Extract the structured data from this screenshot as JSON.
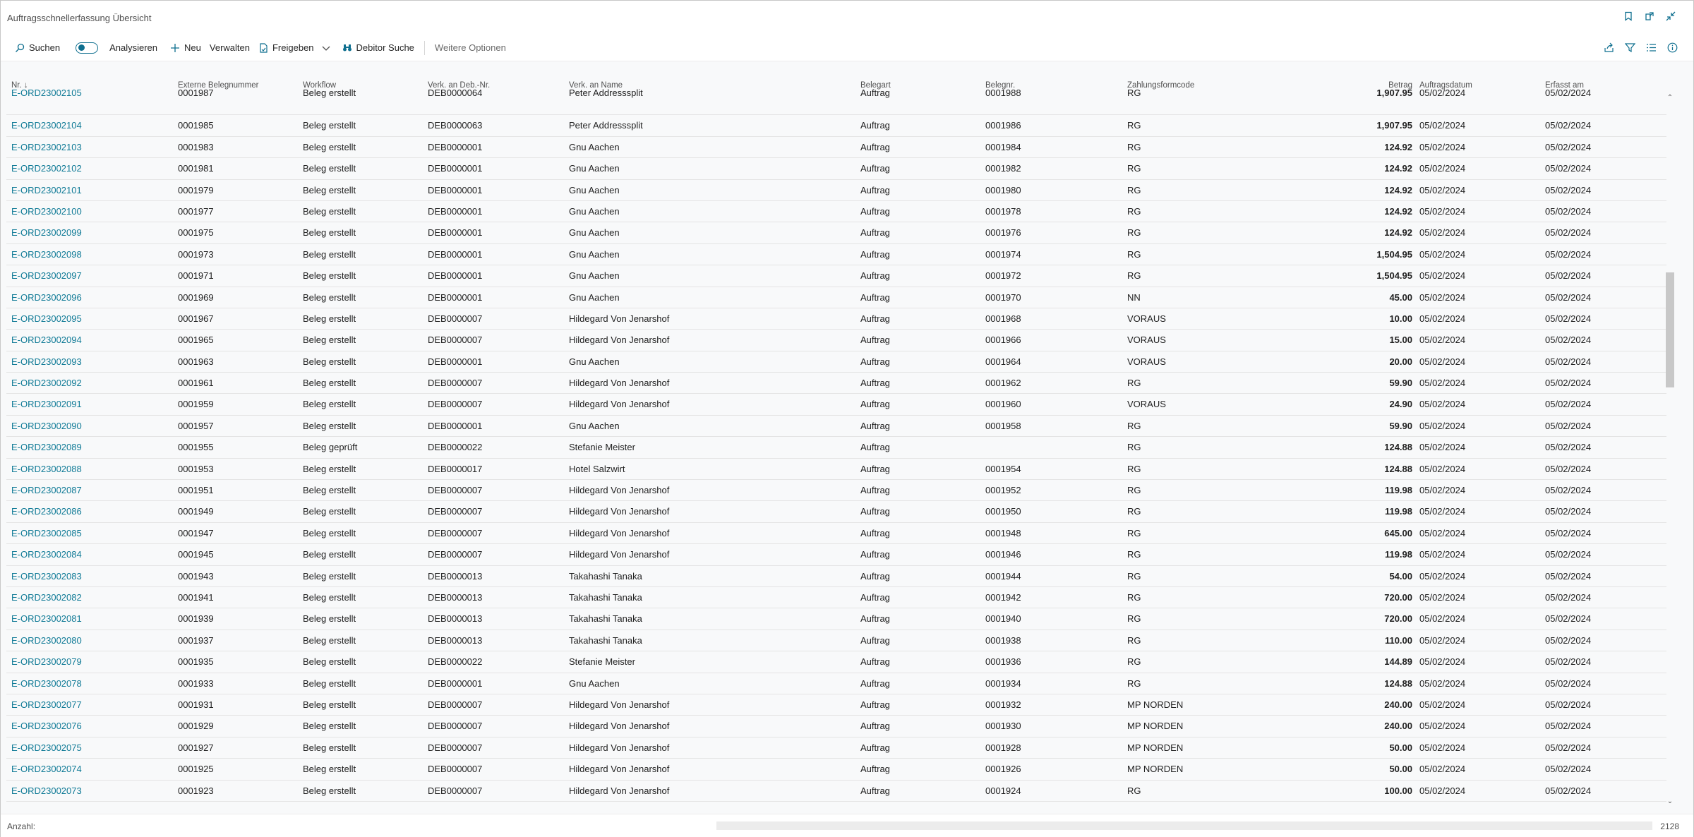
{
  "window": {
    "title": "Auftragsschnellerfassung Übersicht"
  },
  "actions": {
    "search": "Suchen",
    "analyze": "Analysieren",
    "new": "Neu",
    "manage": "Verwalten",
    "release": "Freigeben",
    "debitor_search": "Debitor Suche",
    "more_options": "Weitere Optionen"
  },
  "columns": [
    "Nr. ↓",
    "Externe Belegnummer",
    "Workflow",
    "Verk. an Deb.-Nr.",
    "Verk. an Name",
    "Belegart",
    "Belegnr.",
    "Zahlungsformcode",
    "Betrag",
    "Auftragsdatum",
    "Erfasst am"
  ],
  "rows": [
    [
      "E-ORD23002105",
      "0001987",
      "Beleg erstellt",
      "DEB0000064",
      "Peter Addresssplit",
      "Auftrag",
      "0001988",
      "RG",
      "1,907.95",
      "05/02/2024",
      "05/02/2024"
    ],
    [
      "E-ORD23002104",
      "0001985",
      "Beleg erstellt",
      "DEB0000063",
      "Peter Addresssplit",
      "Auftrag",
      "0001986",
      "RG",
      "1,907.95",
      "05/02/2024",
      "05/02/2024"
    ],
    [
      "E-ORD23002103",
      "0001983",
      "Beleg erstellt",
      "DEB0000001",
      "Gnu Aachen",
      "Auftrag",
      "0001984",
      "RG",
      "124.92",
      "05/02/2024",
      "05/02/2024"
    ],
    [
      "E-ORD23002102",
      "0001981",
      "Beleg erstellt",
      "DEB0000001",
      "Gnu Aachen",
      "Auftrag",
      "0001982",
      "RG",
      "124.92",
      "05/02/2024",
      "05/02/2024"
    ],
    [
      "E-ORD23002101",
      "0001979",
      "Beleg erstellt",
      "DEB0000001",
      "Gnu Aachen",
      "Auftrag",
      "0001980",
      "RG",
      "124.92",
      "05/02/2024",
      "05/02/2024"
    ],
    [
      "E-ORD23002100",
      "0001977",
      "Beleg erstellt",
      "DEB0000001",
      "Gnu Aachen",
      "Auftrag",
      "0001978",
      "RG",
      "124.92",
      "05/02/2024",
      "05/02/2024"
    ],
    [
      "E-ORD23002099",
      "0001975",
      "Beleg erstellt",
      "DEB0000001",
      "Gnu Aachen",
      "Auftrag",
      "0001976",
      "RG",
      "124.92",
      "05/02/2024",
      "05/02/2024"
    ],
    [
      "E-ORD23002098",
      "0001973",
      "Beleg erstellt",
      "DEB0000001",
      "Gnu Aachen",
      "Auftrag",
      "0001974",
      "RG",
      "1,504.95",
      "05/02/2024",
      "05/02/2024"
    ],
    [
      "E-ORD23002097",
      "0001971",
      "Beleg erstellt",
      "DEB0000001",
      "Gnu Aachen",
      "Auftrag",
      "0001972",
      "RG",
      "1,504.95",
      "05/02/2024",
      "05/02/2024"
    ],
    [
      "E-ORD23002096",
      "0001969",
      "Beleg erstellt",
      "DEB0000001",
      "Gnu Aachen",
      "Auftrag",
      "0001970",
      "NN",
      "45.00",
      "05/02/2024",
      "05/02/2024"
    ],
    [
      "E-ORD23002095",
      "0001967",
      "Beleg erstellt",
      "DEB0000007",
      "Hildegard Von Jenarshof",
      "Auftrag",
      "0001968",
      "VORAUS",
      "10.00",
      "05/02/2024",
      "05/02/2024"
    ],
    [
      "E-ORD23002094",
      "0001965",
      "Beleg erstellt",
      "DEB0000007",
      "Hildegard Von Jenarshof",
      "Auftrag",
      "0001966",
      "VORAUS",
      "15.00",
      "05/02/2024",
      "05/02/2024"
    ],
    [
      "E-ORD23002093",
      "0001963",
      "Beleg erstellt",
      "DEB0000001",
      "Gnu Aachen",
      "Auftrag",
      "0001964",
      "VORAUS",
      "20.00",
      "05/02/2024",
      "05/02/2024"
    ],
    [
      "E-ORD23002092",
      "0001961",
      "Beleg erstellt",
      "DEB0000007",
      "Hildegard Von Jenarshof",
      "Auftrag",
      "0001962",
      "RG",
      "59.90",
      "05/02/2024",
      "05/02/2024"
    ],
    [
      "E-ORD23002091",
      "0001959",
      "Beleg erstellt",
      "DEB0000007",
      "Hildegard Von Jenarshof",
      "Auftrag",
      "0001960",
      "VORAUS",
      "24.90",
      "05/02/2024",
      "05/02/2024"
    ],
    [
      "E-ORD23002090",
      "0001957",
      "Beleg erstellt",
      "DEB0000001",
      "Gnu Aachen",
      "Auftrag",
      "0001958",
      "RG",
      "59.90",
      "05/02/2024",
      "05/02/2024"
    ],
    [
      "E-ORD23002089",
      "0001955",
      "Beleg geprüft",
      "DEB0000022",
      "Stefanie Meister",
      "Auftrag",
      "",
      "RG",
      "124.88",
      "05/02/2024",
      "05/02/2024"
    ],
    [
      "E-ORD23002088",
      "0001953",
      "Beleg erstellt",
      "DEB0000017",
      "Hotel Salzwirt",
      "Auftrag",
      "0001954",
      "RG",
      "124.88",
      "05/02/2024",
      "05/02/2024"
    ],
    [
      "E-ORD23002087",
      "0001951",
      "Beleg erstellt",
      "DEB0000007",
      "Hildegard Von Jenarshof",
      "Auftrag",
      "0001952",
      "RG",
      "119.98",
      "05/02/2024",
      "05/02/2024"
    ],
    [
      "E-ORD23002086",
      "0001949",
      "Beleg erstellt",
      "DEB0000007",
      "Hildegard Von Jenarshof",
      "Auftrag",
      "0001950",
      "RG",
      "119.98",
      "05/02/2024",
      "05/02/2024"
    ],
    [
      "E-ORD23002085",
      "0001947",
      "Beleg erstellt",
      "DEB0000007",
      "Hildegard Von Jenarshof",
      "Auftrag",
      "0001948",
      "RG",
      "645.00",
      "05/02/2024",
      "05/02/2024"
    ],
    [
      "E-ORD23002084",
      "0001945",
      "Beleg erstellt",
      "DEB0000007",
      "Hildegard Von Jenarshof",
      "Auftrag",
      "0001946",
      "RG",
      "119.98",
      "05/02/2024",
      "05/02/2024"
    ],
    [
      "E-ORD23002083",
      "0001943",
      "Beleg erstellt",
      "DEB0000013",
      "Takahashi Tanaka",
      "Auftrag",
      "0001944",
      "RG",
      "54.00",
      "05/02/2024",
      "05/02/2024"
    ],
    [
      "E-ORD23002082",
      "0001941",
      "Beleg erstellt",
      "DEB0000013",
      "Takahashi Tanaka",
      "Auftrag",
      "0001942",
      "RG",
      "720.00",
      "05/02/2024",
      "05/02/2024"
    ],
    [
      "E-ORD23002081",
      "0001939",
      "Beleg erstellt",
      "DEB0000013",
      "Takahashi Tanaka",
      "Auftrag",
      "0001940",
      "RG",
      "720.00",
      "05/02/2024",
      "05/02/2024"
    ],
    [
      "E-ORD23002080",
      "0001937",
      "Beleg erstellt",
      "DEB0000013",
      "Takahashi Tanaka",
      "Auftrag",
      "0001938",
      "RG",
      "110.00",
      "05/02/2024",
      "05/02/2024"
    ],
    [
      "E-ORD23002079",
      "0001935",
      "Beleg erstellt",
      "DEB0000022",
      "Stefanie Meister",
      "Auftrag",
      "0001936",
      "RG",
      "144.89",
      "05/02/2024",
      "05/02/2024"
    ],
    [
      "E-ORD23002078",
      "0001933",
      "Beleg erstellt",
      "DEB0000001",
      "Gnu Aachen",
      "Auftrag",
      "0001934",
      "RG",
      "124.88",
      "05/02/2024",
      "05/02/2024"
    ],
    [
      "E-ORD23002077",
      "0001931",
      "Beleg erstellt",
      "DEB0000007",
      "Hildegard Von Jenarshof",
      "Auftrag",
      "0001932",
      "MP NORDEN",
      "240.00",
      "05/02/2024",
      "05/02/2024"
    ],
    [
      "E-ORD23002076",
      "0001929",
      "Beleg erstellt",
      "DEB0000007",
      "Hildegard Von Jenarshof",
      "Auftrag",
      "0001930",
      "MP NORDEN",
      "240.00",
      "05/02/2024",
      "05/02/2024"
    ],
    [
      "E-ORD23002075",
      "0001927",
      "Beleg erstellt",
      "DEB0000007",
      "Hildegard Von Jenarshof",
      "Auftrag",
      "0001928",
      "MP NORDEN",
      "50.00",
      "05/02/2024",
      "05/02/2024"
    ],
    [
      "E-ORD23002074",
      "0001925",
      "Beleg erstellt",
      "DEB0000007",
      "Hildegard Von Jenarshof",
      "Auftrag",
      "0001926",
      "MP NORDEN",
      "50.00",
      "05/02/2024",
      "05/02/2024"
    ],
    [
      "E-ORD23002073",
      "0001923",
      "Beleg erstellt",
      "DEB0000007",
      "Hildegard Von Jenarshof",
      "Auftrag",
      "0001924",
      "RG",
      "100.00",
      "05/02/2024",
      "05/02/2024"
    ]
  ],
  "footer": {
    "count_label": "Anzahl:",
    "count_value": "2128"
  },
  "colors": {
    "accent": "#0f6f8f",
    "link": "#0f7a96"
  }
}
